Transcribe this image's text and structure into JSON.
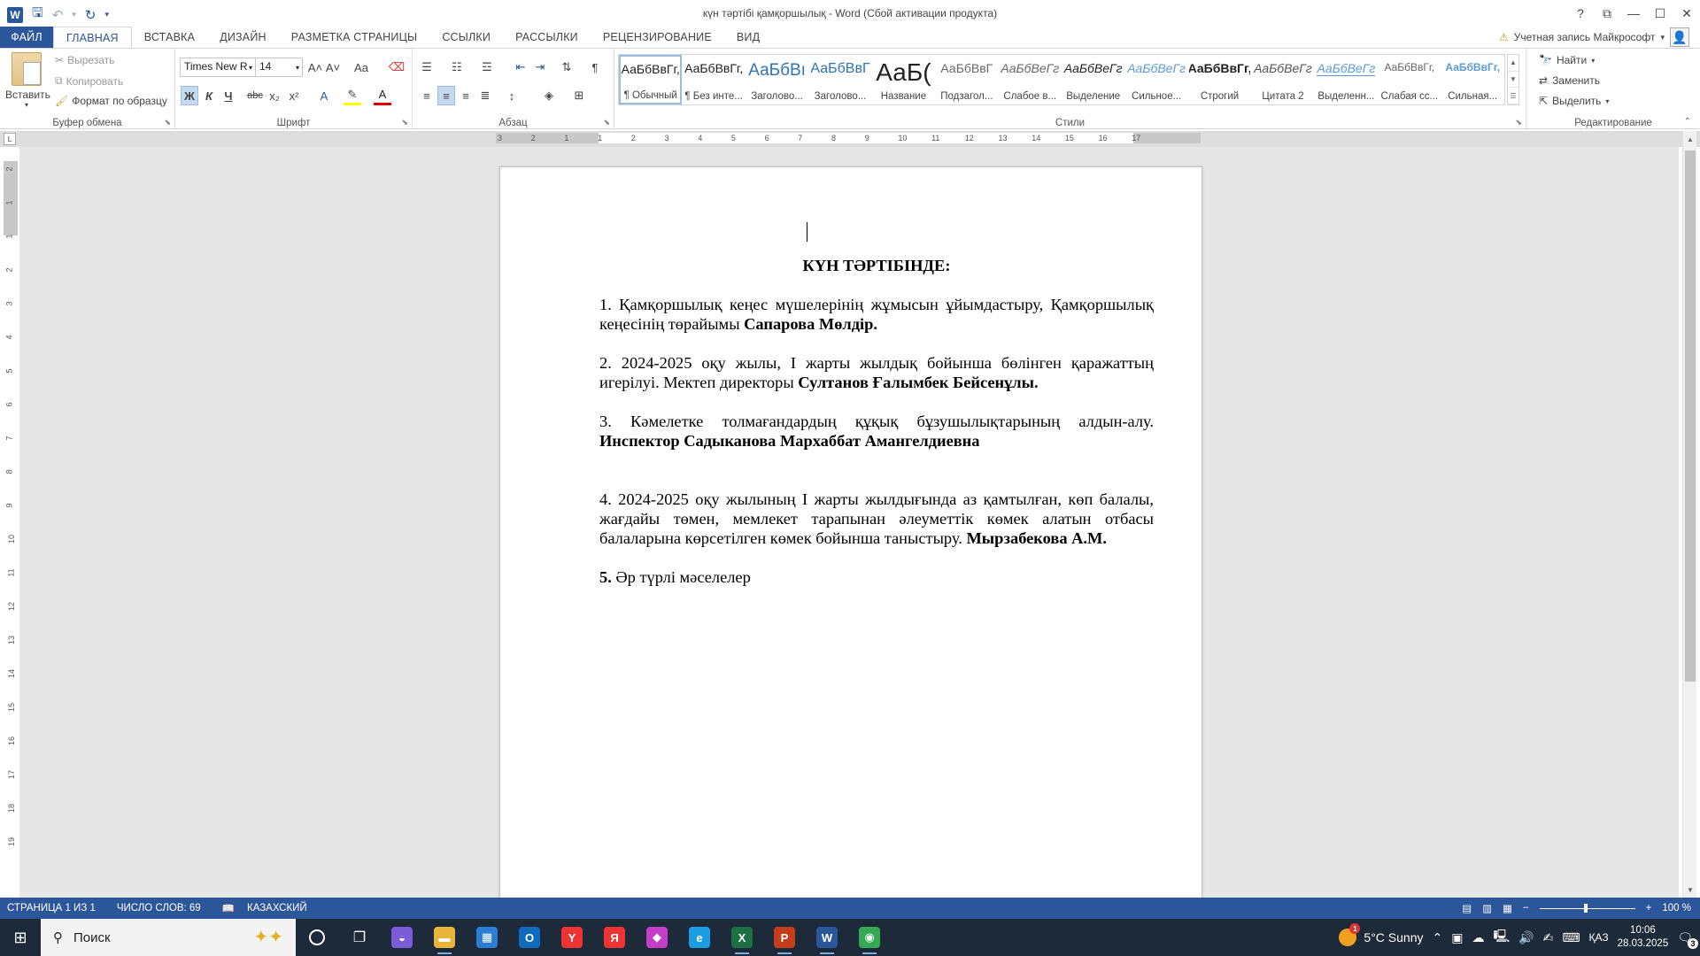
{
  "window": {
    "title": "күн тәртібі қамқоршылық - Word (Сбой активации продукта)",
    "help": "?",
    "controls": [
      "⧉",
      "—",
      "☐",
      "✕"
    ]
  },
  "quick_access": {
    "save_icon": "save-icon",
    "undo_icon": "undo-icon",
    "redo_icon": "redo-icon",
    "customize": "▾"
  },
  "tabs": [
    "ФАЙЛ",
    "ГЛАВНАЯ",
    "ВСТАВКА",
    "ДИЗАЙН",
    "РАЗМЕТКА СТРАНИЦЫ",
    "ССЫЛКИ",
    "РАССЫЛКИ",
    "РЕЦЕНЗИРОВАНИЕ",
    "ВИД"
  ],
  "active_tab": "ГЛАВНАЯ",
  "account": {
    "warning": "⚠",
    "label": "Учетная запись Майкрософт",
    "caret": "▾"
  },
  "ribbon": {
    "clipboard": {
      "label": "Буфер обмена",
      "paste": "Вставить",
      "cut": "Вырезать",
      "copy": "Копировать",
      "format_painter": "Формат по образцу"
    },
    "font": {
      "label": "Шрифт",
      "font_name": "Times New R",
      "font_size": "14",
      "bold": "Ж",
      "italic": "К",
      "underline": "Ч",
      "strike": "abc",
      "sub": "x₂",
      "sup": "x²",
      "grow": "A˄",
      "shrink": "A˅",
      "case": "Aa"
    },
    "paragraph": {
      "label": "Абзац"
    },
    "styles": {
      "label": "Стили",
      "items": [
        {
          "sample": "АаБбВвГг,",
          "name": "¶ Обычный"
        },
        {
          "sample": "АаБбВвГг,",
          "name": "¶ Без инте..."
        },
        {
          "sample": "АаБбВı",
          "name": "Заголово..."
        },
        {
          "sample": "АаБбВвГ",
          "name": "Заголово..."
        },
        {
          "sample": "АаБ(",
          "name": "Название"
        },
        {
          "sample": "АаБбВвГ",
          "name": "Подзагол..."
        },
        {
          "sample": "АаБбВеГг",
          "name": "Слабое в..."
        },
        {
          "sample": "АаБбВеГг",
          "name": "Выделение"
        },
        {
          "sample": "АаБбВеГг",
          "name": "Сильное..."
        },
        {
          "sample": "АаБбВвГг,",
          "name": "Строгий"
        },
        {
          "sample": "АаБбВеГг",
          "name": "Цитата 2"
        },
        {
          "sample": "АаБбВеГг",
          "name": "Выделенн..."
        },
        {
          "sample": "АаБбВвГг,",
          "name": "Слабая сс..."
        },
        {
          "sample": "АаБбВвГг,",
          "name": "Сильная..."
        }
      ]
    },
    "editing": {
      "label": "Редактирование",
      "find": "Найти",
      "replace": "Заменить",
      "select": "Выделить"
    }
  },
  "ruler_numbers": [
    "3",
    "2",
    "1",
    "1",
    "2",
    "3",
    "4",
    "5",
    "6",
    "7",
    "8",
    "9",
    "10",
    "11",
    "12",
    "13",
    "14",
    "15",
    "16",
    "17"
  ],
  "vruler_numbers": [
    "2",
    "1",
    "1",
    "2",
    "3",
    "4",
    "5",
    "6",
    "7",
    "8",
    "9",
    "10",
    "11",
    "12",
    "13",
    "14",
    "15",
    "16",
    "17",
    "18",
    "19"
  ],
  "document": {
    "heading": "КҮН ТӘРТІБІНДЕ:",
    "items": [
      {
        "text": "1. Қамқоршылық кеңес мүшелерінің жұмысын ұйымдастыру, Қамқоршылық кеңесінің төрайымы ",
        "bold": "Сапарова Мөлдір."
      },
      {
        "text": "2. 2024-2025 оқу жылы, І жарты жылдық бойынша бөлінген қаражаттың игерілуі.  Мектеп директоры ",
        "bold": "Султанов Ғалымбек Бейсенұлы."
      },
      {
        "text": "3. Кәмелетке толмағандардың құқық бұзушылықтарының алдын-алу. ",
        "bold": "Инспектор Садыканова Мархаббат Амангелдиевна"
      },
      {
        "text": "4. 2024-2025 оқу жылының І жарты жылдығында аз қамтылған, көп балалы, жағдайы төмен, мемлекет тарапынан әлеуметтік көмек алатын отбасы балаларына көрсетілген  көмек бойынша таныстыру. ",
        "bold": "Мырзабекова А.М."
      },
      {
        "text": " Әр түрлі мәселелер",
        "bold": "5."
      }
    ]
  },
  "status": {
    "page": "СТРАНИЦА 1 ИЗ 1",
    "words": "ЧИСЛО СЛОВ: 69",
    "lang": "КАЗАХСКИЙ",
    "zoom": "100 %",
    "zoom_minus": "−",
    "zoom_plus": "+"
  },
  "taskbar": {
    "search_placeholder": "Поиск",
    "weather": "5°C  Sunny",
    "weather_badge": "1",
    "lang": "ҚАЗ",
    "time": "10:06",
    "date": "28.03.2025",
    "notif_count": "3",
    "apps": [
      {
        "name": "copilot-app-icon",
        "glyph": "◒",
        "color": "#7b5cd6"
      },
      {
        "name": "explorer-app-icon",
        "glyph": "▬",
        "color": "#e8b43a",
        "open": true
      },
      {
        "name": "store-app-icon",
        "glyph": "▦",
        "color": "#2a7fd4"
      },
      {
        "name": "outlook-app-icon",
        "glyph": "O",
        "color": "#0f6cbd"
      },
      {
        "name": "yandex-browser-app-icon",
        "glyph": "Y",
        "color": "#e33"
      },
      {
        "name": "yandex-app-icon",
        "glyph": "Я",
        "color": "#e33"
      },
      {
        "name": "m365-app-icon",
        "glyph": "◆",
        "color": "#c43ec8"
      },
      {
        "name": "edge-app-icon",
        "glyph": "e",
        "color": "#1b9de2"
      },
      {
        "name": "excel-app-icon",
        "glyph": "X",
        "color": "#1d7044",
        "open": true
      },
      {
        "name": "powerpoint-app-icon",
        "glyph": "P",
        "color": "#c43e1c",
        "open": true
      },
      {
        "name": "word-app-icon",
        "glyph": "W",
        "color": "#2b579a",
        "open": true
      },
      {
        "name": "chrome-app-icon",
        "glyph": "◉",
        "color": "#34a853",
        "open": true
      }
    ]
  }
}
